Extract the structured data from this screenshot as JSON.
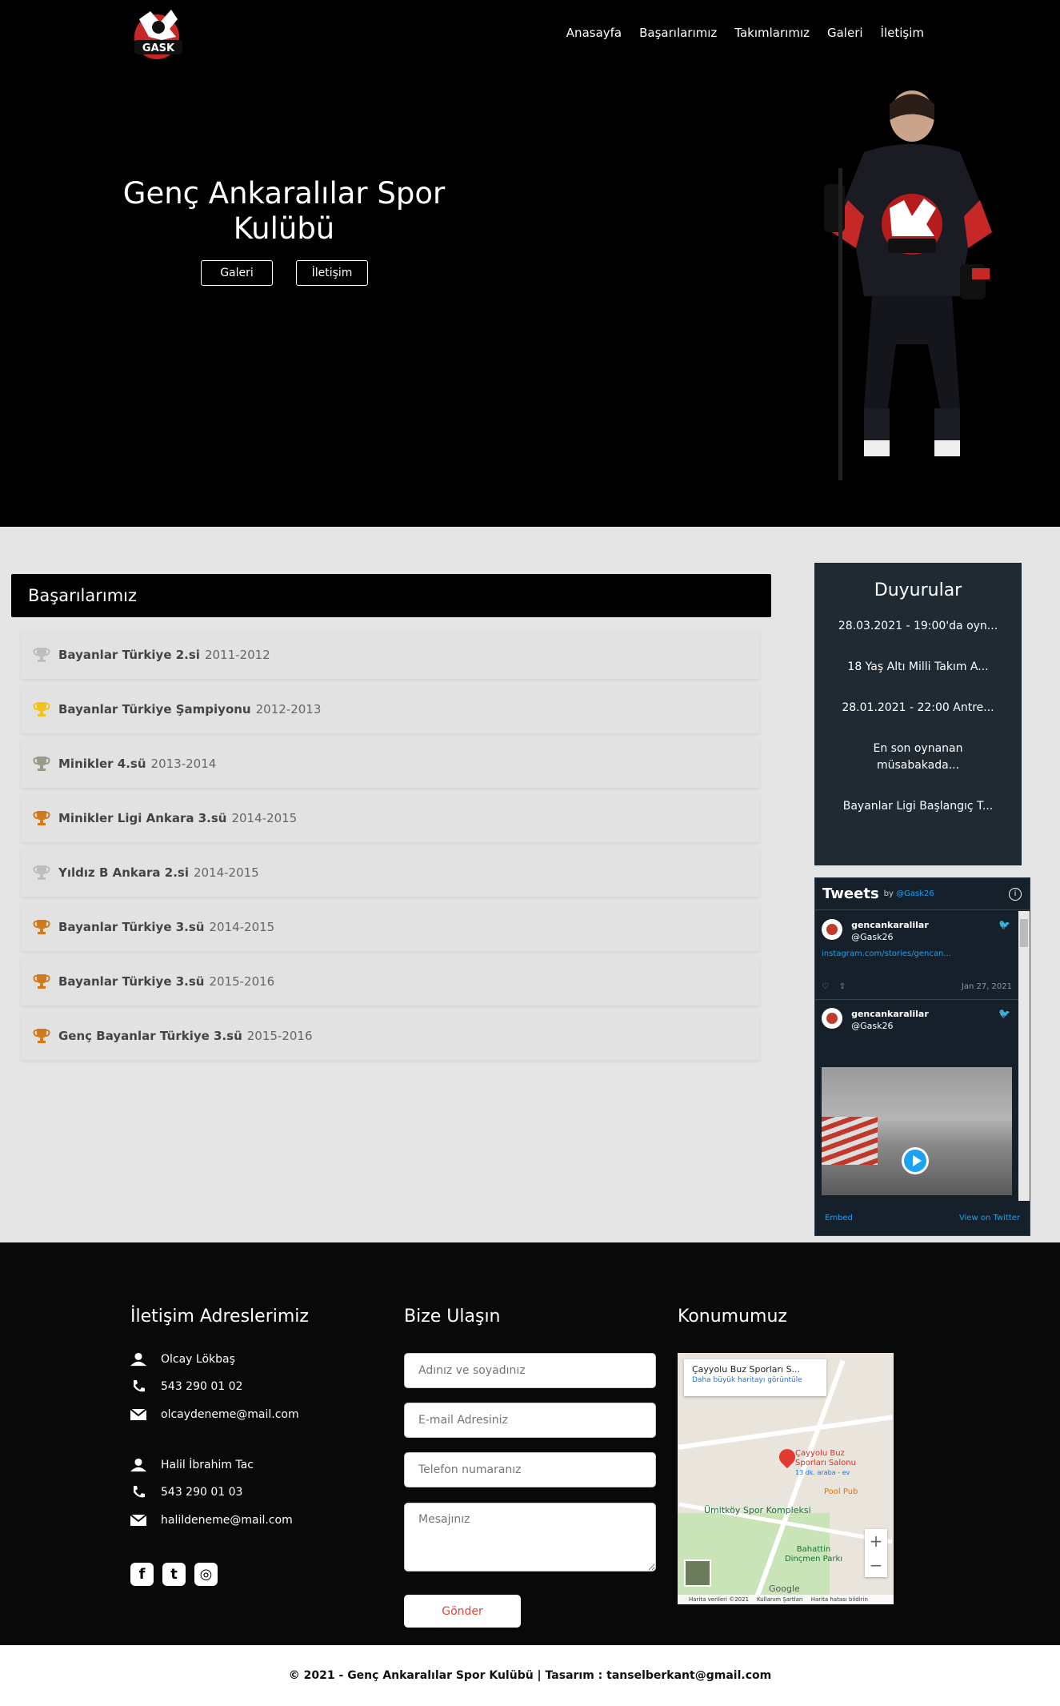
{
  "header": {
    "logo_text": "GASK",
    "nav": [
      "Anasayfa",
      "Başarılarımız",
      "Takımlarımız",
      "Galeri",
      "İletişim"
    ]
  },
  "hero": {
    "title": "Genç Ankaralılar Spor Kulübü",
    "buttons": [
      "Galeri",
      "İletişim"
    ]
  },
  "achievements": {
    "title": "Başarılarımız",
    "items": [
      {
        "name": "Bayanlar Türkiye 2.si",
        "years": "2011-2012",
        "medal": "silver"
      },
      {
        "name": "Bayanlar Türkiye Şampiyonu",
        "years": "2012-2013",
        "medal": "gold"
      },
      {
        "name": "Minikler 4.sü",
        "years": "2013-2014",
        "medal": "grey"
      },
      {
        "name": "Minikler Ligi Ankara 3.sü",
        "years": "2014-2015",
        "medal": "bronze"
      },
      {
        "name": "Yıldız B Ankara 2.si",
        "years": "2014-2015",
        "medal": "silver"
      },
      {
        "name": "Bayanlar Türkiye 3.sü",
        "years": "2014-2015",
        "medal": "bronze"
      },
      {
        "name": "Bayanlar Türkiye 3.sü",
        "years": "2015-2016",
        "medal": "bronze"
      },
      {
        "name": "Genç Bayanlar Türkiye 3.sü",
        "years": "2015-2016",
        "medal": "bronze"
      }
    ],
    "medal_colors": {
      "gold": "#f3c315",
      "silver": "#bdbdbd",
      "bronze": "#d17a1c",
      "grey": "#9a9a8a"
    }
  },
  "announcements": {
    "title": "Duyurular",
    "items": [
      "28.03.2021 - 19:00'da oyn...",
      "18 Yaş Altı Milli Takım A...",
      "28.01.2021 - 22:00 Antre...",
      "En son oynanan müsabakada...",
      "Bayanlar Ligi Başlangıç T..."
    ]
  },
  "tweets": {
    "title": "Tweets",
    "by": "by",
    "handle_link": "@Gask26",
    "info": "i",
    "items": [
      {
        "name": "gencankaralilar",
        "handle": "@Gask26",
        "link": "instagram.com/stories/gencan...",
        "date": "Jan 27, 2021"
      },
      {
        "name": "gencankaralilar",
        "handle": "@Gask26"
      }
    ],
    "embed": "Embed",
    "view": "View on Twitter"
  },
  "footer": {
    "contact_title": "İletişim Adreslerimiz",
    "contacts": [
      {
        "name": "Olcay Lökbaş",
        "phone": "543 290 01 02",
        "email": "olcaydeneme@mail.com"
      },
      {
        "name": "Halil İbrahim Tac",
        "phone": "543 290 01 03",
        "email": "halildeneme@mail.com"
      }
    ],
    "social": [
      "facebook-icon",
      "twitter-icon",
      "instagram-icon"
    ],
    "form_title": "Bize Ulaşın",
    "form": {
      "name_placeholder": "Adınız ve soyadınız",
      "email_placeholder": "E-mail Adresiniz",
      "phone_placeholder": "Telefon numaranız",
      "message_placeholder": "Mesajınız",
      "send": "Gönder"
    },
    "map_title": "Konumumuz",
    "map": {
      "place": "Çayyolu Buz Sporları S...",
      "larger": "Daha büyük haritayı görüntüle",
      "pin_label": "Çayyolu Buz Sporları Salonu",
      "pin_sub": "13 dk. araba - ev",
      "pool": "Pool Pub",
      "umit": "Ümitköy Spor Kompleksi",
      "park": "Bahattin Dinçmen Parkı",
      "google": "Google",
      "attr1": "Harita verileri ©2021",
      "attr2": "Kullanım Şartları",
      "attr3": "Harita hatası bildirin"
    }
  },
  "copyright": "© 2021 - Genç Ankaralılar Spor Kulübü | Tasarım : tanselberkant@gmail.com"
}
